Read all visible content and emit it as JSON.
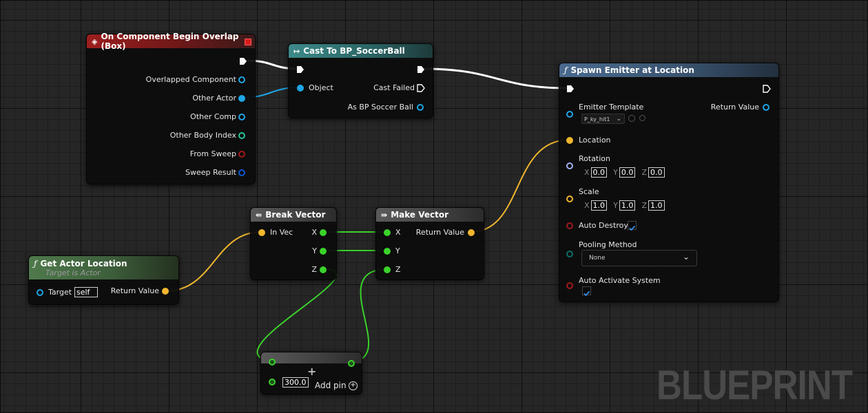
{
  "watermark": "BLUEPRINT",
  "colors": {
    "exec": "#ffffff",
    "object": "#1ea6e6",
    "vector": "#f0b62e",
    "rotator": "#a0aff0",
    "float": "#3ad22a",
    "int": "#27c59f",
    "bool": "#a1191c",
    "struct": "#0c5ad2",
    "byte": "#0c6e65"
  },
  "nodes": {
    "overlap": {
      "title": "On Component Begin Overlap (Box)",
      "pins": [
        "Overlapped Component",
        "Other Actor",
        "Other Comp",
        "Other Body Index",
        "From Sweep",
        "Sweep Result"
      ]
    },
    "cast": {
      "title": "Cast To BP_SoccerBall",
      "object": "Object",
      "cast_failed": "Cast Failed",
      "as_ball": "As BP Soccer Ball"
    },
    "spawn": {
      "title": "Spawn Emitter at Location",
      "emitter_template": "Emitter Template",
      "template_value": "P_ky_hit1",
      "return_value": "Return Value",
      "location": "Location",
      "rotation": "Rotation",
      "rotation_x": "0.0",
      "rotation_y": "0.0",
      "rotation_z": "0.0",
      "scale": "Scale",
      "scale_x": "1.0",
      "scale_y": "1.0",
      "scale_z": "1.0",
      "auto_destroy": "Auto Destroy",
      "pooling_method": "Pooling Method",
      "pooling_value": "None",
      "auto_activate": "Auto Activate System",
      "lbl_x": "X",
      "lbl_y": "Y",
      "lbl_z": "Z"
    },
    "get_loc": {
      "title": "Get Actor Location",
      "subtitle": "Target is Actor",
      "target": "Target",
      "target_value": "self",
      "return_value": "Return Value"
    },
    "break_vec": {
      "title": "Break Vector",
      "in_vec": "In Vec",
      "x": "X",
      "y": "Y",
      "z": "Z"
    },
    "make_vec": {
      "title": "Make Vector",
      "x": "X",
      "y": "Y",
      "z": "Z",
      "return_value": "Return Value"
    },
    "add": {
      "value": "300.0",
      "add_pin": "Add pin"
    }
  }
}
